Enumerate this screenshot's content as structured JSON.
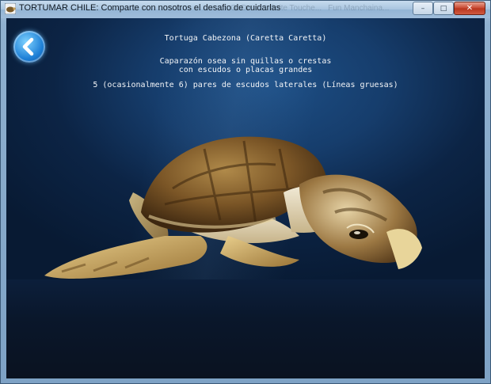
{
  "window": {
    "title": "TORTUMAR CHILE: Comparte con nosotros el desafio de cuidarlas",
    "background_tabs": [
      "Ot De...",
      "Infinite Touche...",
      "Fun Manchaina..."
    ],
    "controls": {
      "minimize": "–",
      "maximize": "□",
      "close": "✕"
    }
  },
  "content": {
    "heading": "Tortuga Cabezona (Caretta Caretta)",
    "description_line1": "Caparazón osea sin quillas o crestas",
    "description_line2": "con escudos o placas grandes",
    "detail": "5 (ocasionalmente 6) pares de escudos laterales (Líneas gruesas)"
  },
  "icons": {
    "app": "turtle-app-icon",
    "back": "back-arrow-icon"
  },
  "colors": {
    "accent": "#1d7fd6",
    "text": "#f2f4f7",
    "background": "#0c2445"
  }
}
